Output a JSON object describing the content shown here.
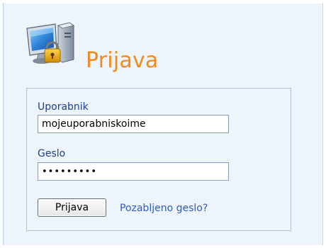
{
  "header": {
    "title": "Prijava",
    "icon": "computer-lock-icon"
  },
  "login_form": {
    "username_label": "Uporabnik",
    "username_value": "mojeuporabniskoime",
    "password_label": "Geslo",
    "password_value": "xxxxxxxxx",
    "submit_label": "Prijava",
    "forgot_link": "Pozabljeno geslo?"
  },
  "colors": {
    "background": "#eef4fb",
    "title": "#f28a1d",
    "label": "#1f3f8a",
    "link": "#2f5dbe",
    "border": "#afc2d9"
  }
}
